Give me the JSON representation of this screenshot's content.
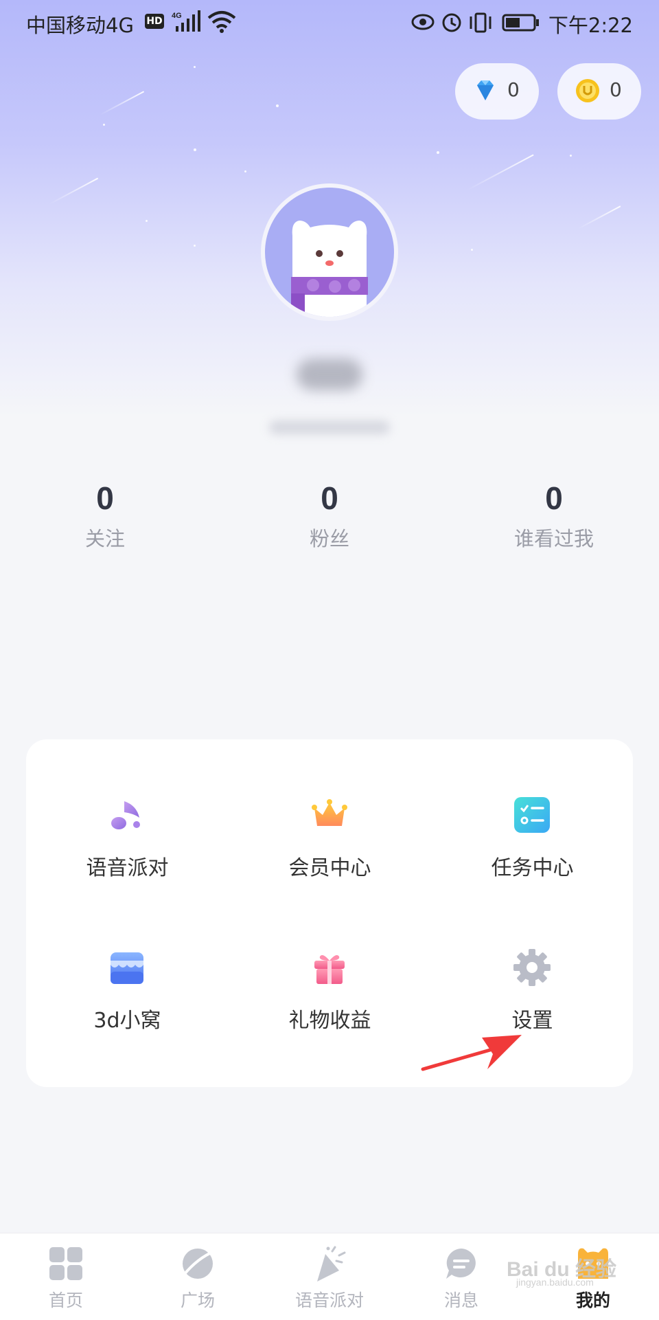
{
  "status_bar": {
    "carrier": "中国移动4G",
    "hd_badge": "HD",
    "time": "下午2:22"
  },
  "wallet": {
    "diamonds": "0",
    "coins": "0"
  },
  "stats": [
    {
      "value": "0",
      "label": "关注"
    },
    {
      "value": "0",
      "label": "粉丝"
    },
    {
      "value": "0",
      "label": "谁看过我"
    }
  ],
  "functions": [
    {
      "label": "语音派对",
      "icon": "music-note-icon"
    },
    {
      "label": "会员中心",
      "icon": "crown-icon"
    },
    {
      "label": "任务中心",
      "icon": "task-list-icon"
    },
    {
      "label": "3d小窝",
      "icon": "shop-icon"
    },
    {
      "label": "礼物收益",
      "icon": "gift-icon"
    },
    {
      "label": "设置",
      "icon": "gear-icon"
    }
  ],
  "tabs": [
    {
      "label": "首页",
      "icon": "grid-icon"
    },
    {
      "label": "广场",
      "icon": "planet-icon"
    },
    {
      "label": "语音派对",
      "icon": "party-popper-icon"
    },
    {
      "label": "消息",
      "icon": "chat-bubble-icon"
    },
    {
      "label": "我的",
      "icon": "cat-avatar-icon",
      "active": true
    }
  ],
  "colors": {
    "hero_top": "#b4b8fa",
    "page_bg": "#f5f6f9",
    "accent_arrow": "#f03a3a"
  },
  "watermark": {
    "logo": "Bai du 经验",
    "url": "jingyan.baidu.com"
  }
}
